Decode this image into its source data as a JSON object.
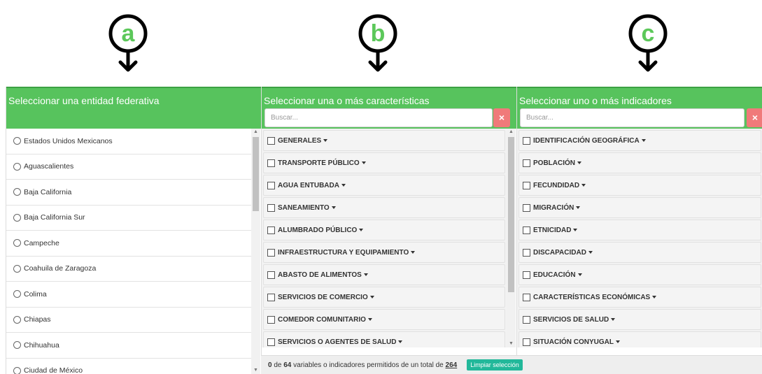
{
  "markers": [
    {
      "letter": "a"
    },
    {
      "letter": "b"
    },
    {
      "letter": "c"
    }
  ],
  "colors": {
    "accent": "#57c35d",
    "clear": "#f07a7a",
    "button": "#22b89a"
  },
  "panel_a": {
    "title": "Seleccionar una entidad federativa",
    "items": [
      "Estados Unidos Mexicanos",
      "Aguascalientes",
      "Baja California",
      "Baja California Sur",
      "Campeche",
      "Coahuila de Zaragoza",
      "Colima",
      "Chiapas",
      "Chihuahua",
      "Ciudad de México"
    ]
  },
  "panel_b": {
    "title": "Seleccionar una o más características",
    "search_placeholder": "Buscar...",
    "clear_icon": "×",
    "items": [
      "GENERALES",
      "TRANSPORTE PÚBLICO",
      "AGUA ENTUBADA",
      "SANEAMIENTO",
      "ALUMBRADO PÚBLICO",
      "INFRAESTRUCTURA Y EQUIPAMIENTO",
      "ABASTO DE ALIMENTOS",
      "SERVICIOS DE COMERCIO",
      "COMEDOR COMUNITARIO",
      "SERVICIOS O AGENTES DE SALUD"
    ]
  },
  "panel_c": {
    "title": "Seleccionar uno o más indicadores",
    "search_placeholder": "Buscar...",
    "clear_icon": "×",
    "items": [
      "IDENTIFICACIÓN GEOGRÁFICA",
      "POBLACIÓN",
      "FECUNDIDAD",
      "MIGRACIÓN",
      "ETNICIDAD",
      "DISCAPACIDAD",
      "EDUCACIÓN",
      "CARACTERÍSTICAS ECONÓMICAS",
      "SERVICIOS DE SALUD",
      "SITUACIÓN CONYUGAL"
    ]
  },
  "footer": {
    "selected": "0",
    "text_1": "de",
    "max": "64",
    "text_2": "variables o indicadores permitidos de un total de",
    "total": "264",
    "clear_button": "Limpiar selección"
  }
}
